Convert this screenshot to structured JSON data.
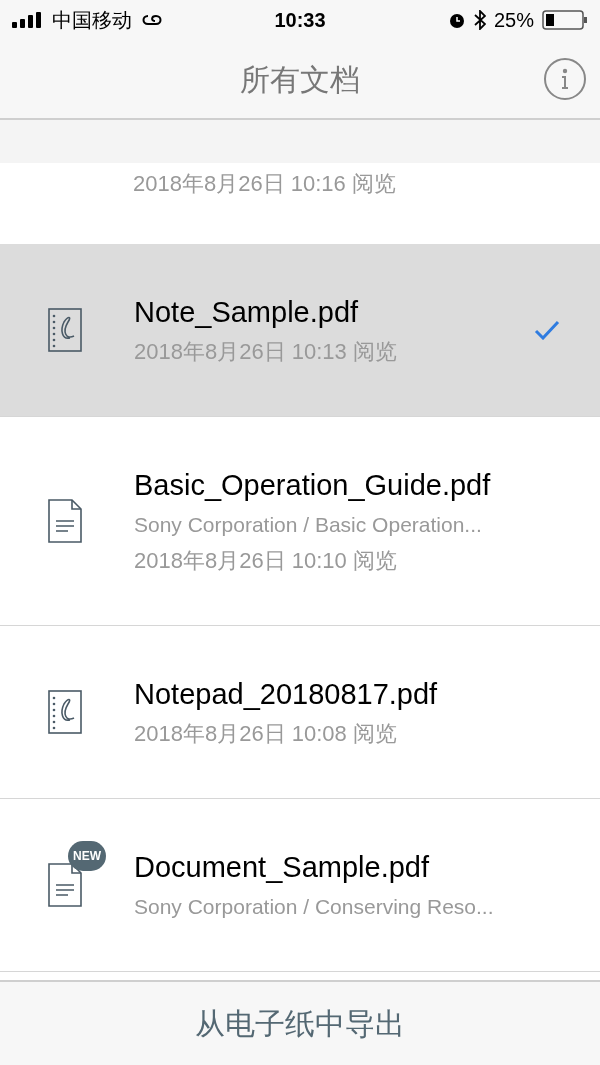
{
  "status_bar": {
    "carrier": "中国移动",
    "time": "10:33",
    "battery": "25%"
  },
  "nav": {
    "title": "所有文档"
  },
  "documents": [
    {
      "kind": "partial",
      "selected": false,
      "date": "2018年8月26日 10:16 阅览"
    },
    {
      "kind": "notebook",
      "selected": true,
      "title": "Note_Sample.pdf",
      "date": "2018年8月26日 10:13 阅览"
    },
    {
      "kind": "document",
      "selected": false,
      "title": "Basic_Operation_Guide.pdf",
      "subtitle": "Sony Corporation / Basic Operation...",
      "date": "2018年8月26日 10:10 阅览"
    },
    {
      "kind": "notebook",
      "selected": false,
      "title": "Notepad_20180817.pdf",
      "date": "2018年8月26日 10:08 阅览"
    },
    {
      "kind": "document",
      "selected": false,
      "badge": "NEW",
      "title": "Document_Sample.pdf",
      "subtitle": "Sony Corporation / Conserving Reso..."
    }
  ],
  "bottom_bar": {
    "label": "从电子纸中导出"
  }
}
